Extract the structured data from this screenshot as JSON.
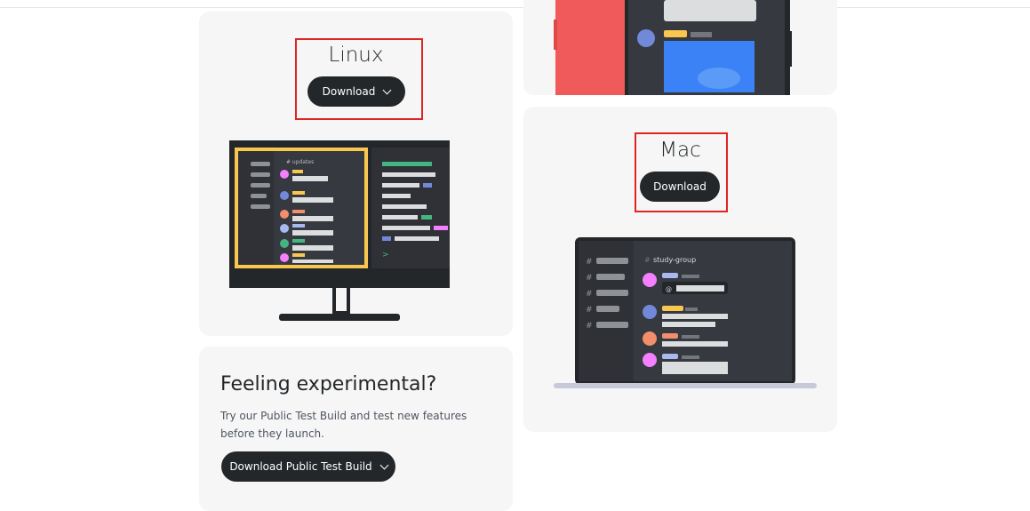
{
  "linux": {
    "title": "Linux",
    "button_label": "Download"
  },
  "mac": {
    "title": "Mac",
    "button_label": "Download",
    "channel_name": "study-group"
  },
  "experimental": {
    "title": "Feeling experimental?",
    "description": "Try our Public Test Build and test new features before they launch.",
    "button_label": "Download Public Test Build"
  },
  "colors": {
    "button": "#23272a",
    "card": "#f6f6f6",
    "highlight": "#e02424",
    "accent_yellow": "#f9c74f"
  },
  "icons": [
    "chevron-down-icon"
  ]
}
